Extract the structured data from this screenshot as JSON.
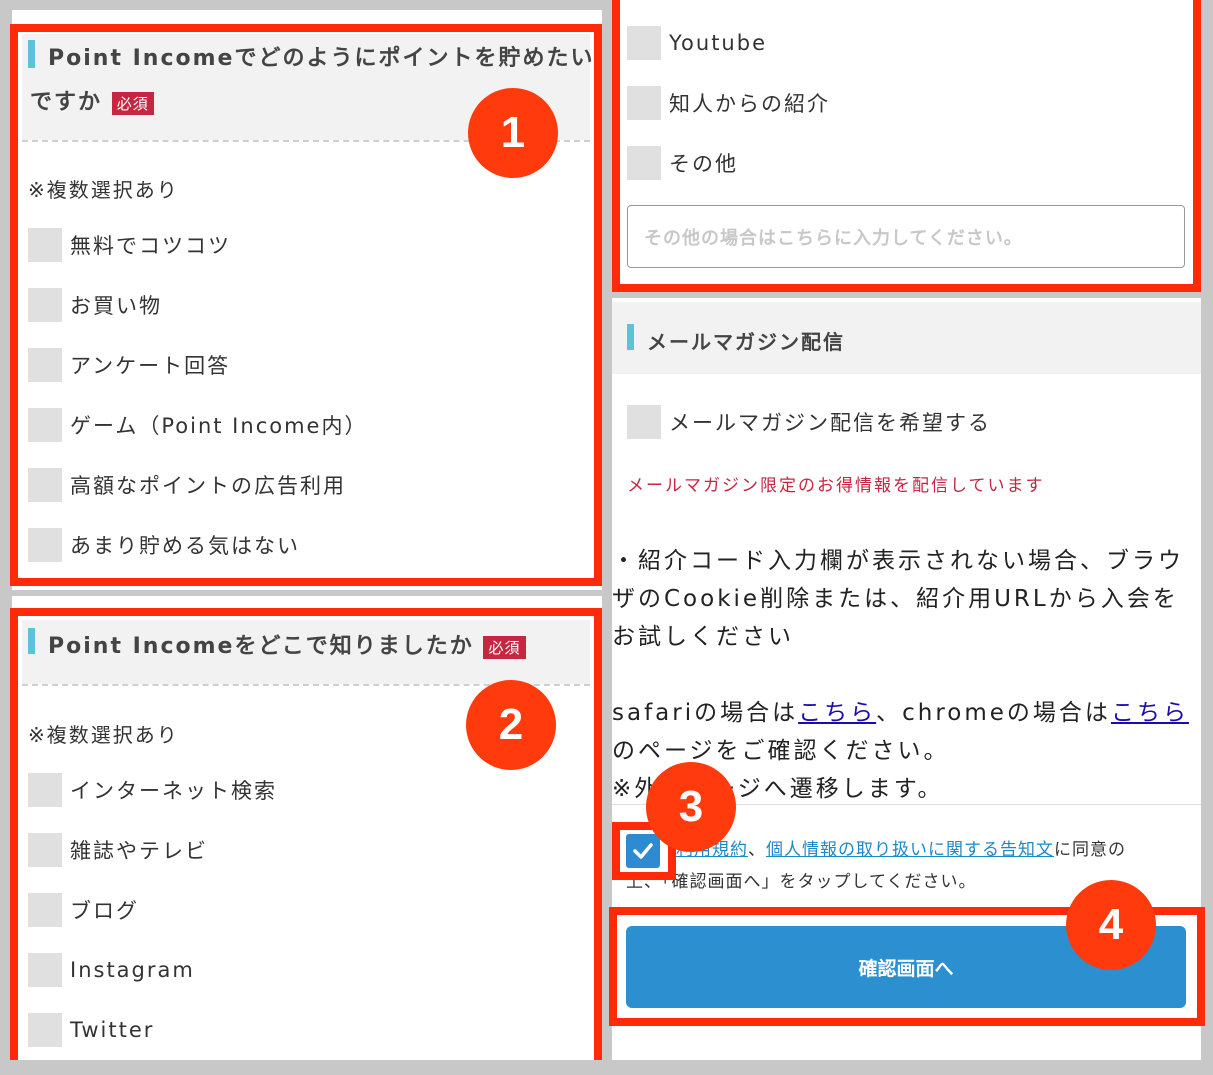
{
  "q1": {
    "title_line1": "Point Incomeでどのようにポイントを貯めたい",
    "title_line2": "ですか",
    "required": "必須",
    "note": "※複数選択あり",
    "options": [
      "無料でコツコツ",
      "お買い物",
      "アンケート回答",
      "ゲーム（Point Income内）",
      "高額なポイントの広告利用",
      "あまり貯める気はない"
    ]
  },
  "q2": {
    "title": "Point Incomeをどこで知りましたか",
    "required": "必須",
    "note": "※複数選択あり",
    "options": [
      "インターネット検索",
      "雑誌やテレビ",
      "ブログ",
      "Instagram",
      "Twitter",
      "Youtube",
      "知人からの紹介",
      "その他"
    ],
    "other_placeholder": "その他の場合はこちらに入力してください。"
  },
  "newsletter": {
    "title": "メールマガジン配信",
    "option": "メールマガジン配信を希望する",
    "promo": "メールマガジン限定のお得情報を配信しています"
  },
  "info": {
    "line1": "・紹介コード入力欄が表示されない場合、ブラウ",
    "line2": "ザのCookie削除または、紹介用URLから入会を",
    "line3": "お試しください",
    "safari_prefix": "safariの場合は",
    "safari_link": "こちら",
    "chrome_prefix": "、chromeの場合は",
    "chrome_link": "こちら",
    "line5": "のページをご確認ください。",
    "line6": "※外部ページへ遷移します。"
  },
  "agree": {
    "terms_link": "利用規約",
    "sep": "、",
    "privacy_link": "個人情報の取り扱いに関する告知文",
    "suffix": "に同意の",
    "line2": "上、「確認画面へ」をタップしてください。"
  },
  "submit_label": "確認画面へ",
  "badges": [
    "1",
    "2",
    "3",
    "4"
  ],
  "colors": {
    "highlight": "#ff2a0a",
    "accent_bar": "#5ec3d9",
    "required": "#c62641",
    "submit": "#2b8fd0"
  }
}
